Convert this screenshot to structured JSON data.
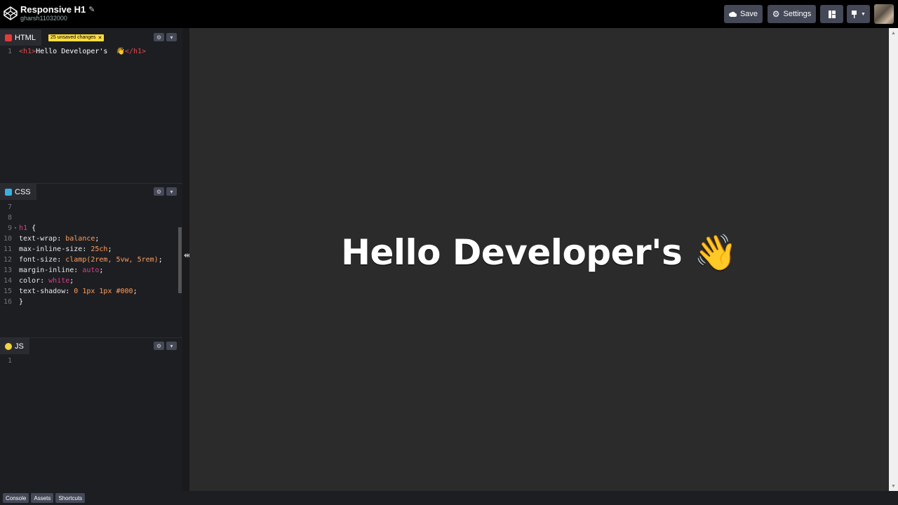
{
  "header": {
    "title": "Responsive H1",
    "username": "gharsh11032000",
    "save_label": "Save",
    "settings_label": "Settings"
  },
  "html_panel": {
    "label": "HTML",
    "unsaved_badge": "25 unsaved changes",
    "lines": [
      {
        "n": "1",
        "open": "<h1>",
        "text": "Hello Developer's  👋",
        "close": "</h1>"
      }
    ]
  },
  "css_panel": {
    "label": "CSS",
    "lines": [
      {
        "n": "7"
      },
      {
        "n": "8"
      },
      {
        "n": "9",
        "selector": "h1",
        "brace": " {"
      },
      {
        "n": "10",
        "prop": "text-wrap",
        "val": "balance"
      },
      {
        "n": "11",
        "prop": "max-inline-size",
        "val": "25ch"
      },
      {
        "n": "12",
        "prop": "font-size",
        "val": "clamp(2rem, 5vw, 5rem)"
      },
      {
        "n": "13",
        "prop": "margin-inline",
        "val": "auto"
      },
      {
        "n": "14",
        "prop": "color",
        "val": "white"
      },
      {
        "n": "15",
        "prop": "text-shadow",
        "val": "0 1px 1px #000"
      },
      {
        "n": "16",
        "close": "}"
      }
    ]
  },
  "js_panel": {
    "label": "JS",
    "lines": [
      {
        "n": "1"
      }
    ]
  },
  "preview": {
    "heading": "Hello Developer's 👋"
  },
  "footer": {
    "console_label": "Console",
    "assets_label": "Assets",
    "shortcuts_label": "Shortcuts"
  },
  "icons": {
    "logo": "codepen-logo-icon",
    "pencil": "pencil-icon",
    "save": "cloud-icon",
    "settings": "gear-icon",
    "layout": "layout-icon",
    "pin": "pin-icon"
  },
  "colors": {
    "accent_badge": "#ffdd40",
    "html_dot": "#e23b3b",
    "css_dot": "#3ab0e2",
    "js_dot": "#f5d33d"
  }
}
